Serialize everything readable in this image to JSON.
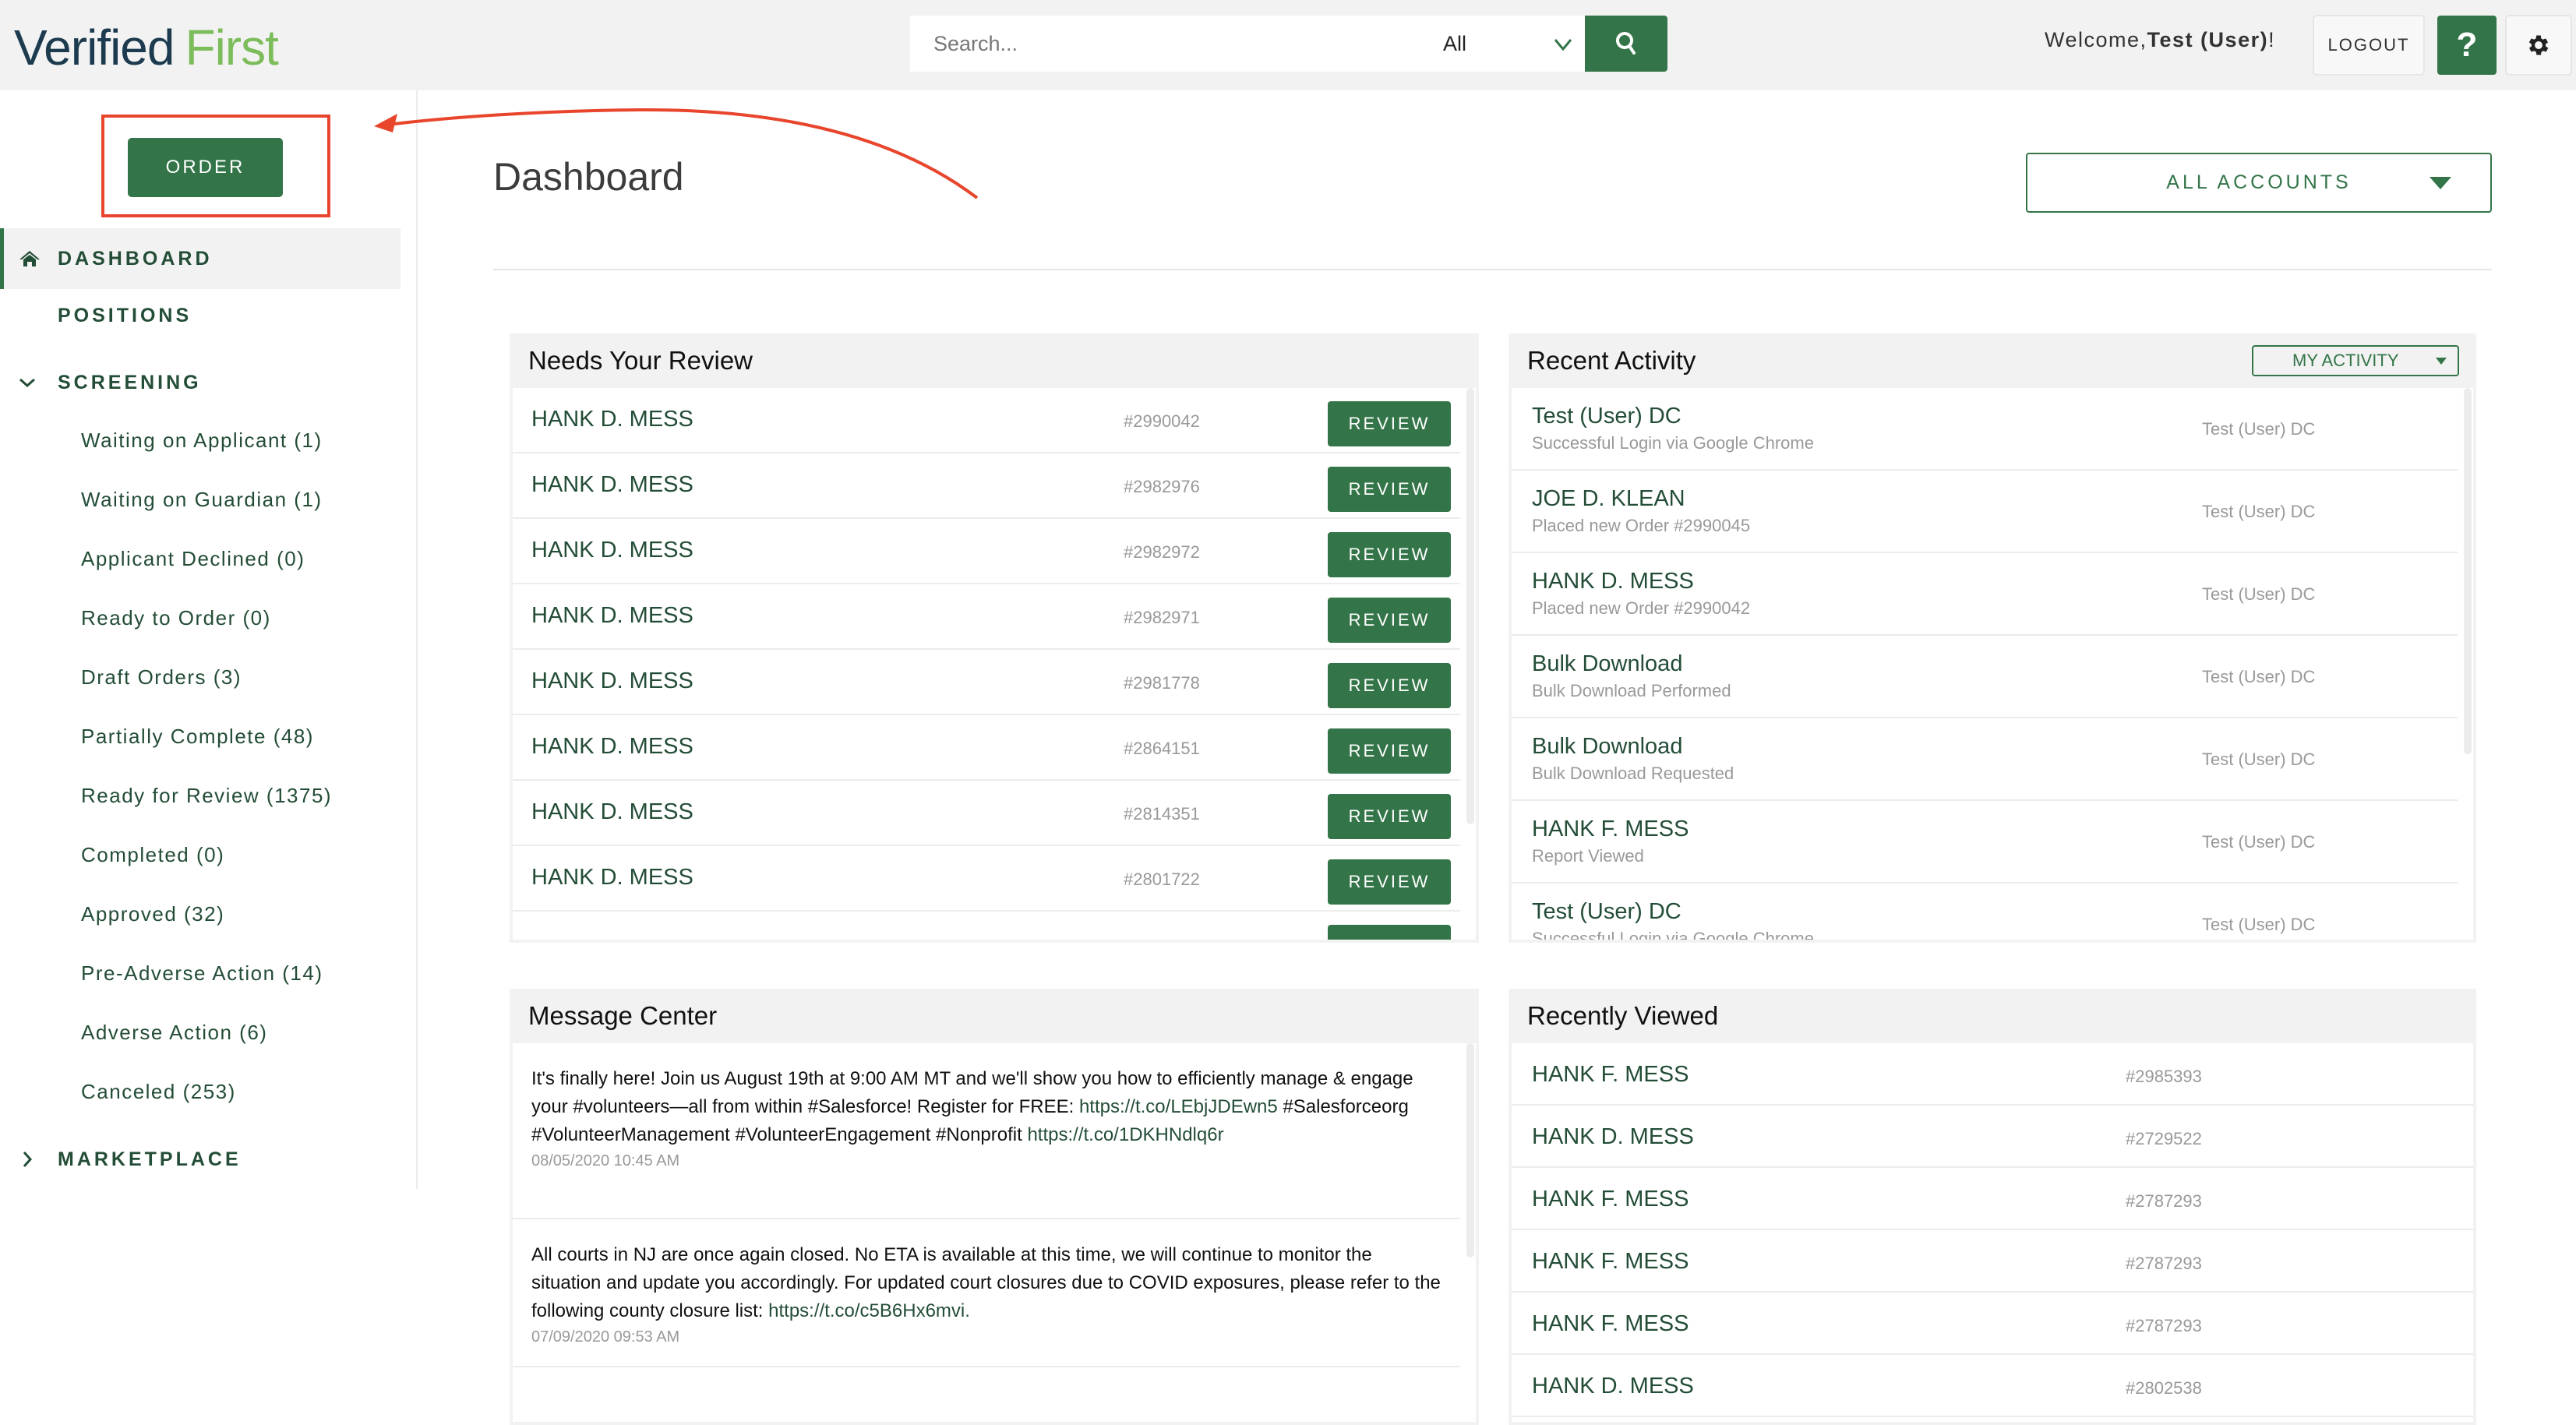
{
  "header": {
    "logo_part1": "Verified",
    "logo_part2": "First",
    "search_placeholder": "Search...",
    "search_scope": "All",
    "welcome_prefix": "Welcome,",
    "welcome_user": "Test (User)",
    "welcome_suffix": "!",
    "logout_label": "LOGOUT",
    "help_label": "?"
  },
  "sidebar": {
    "order_label": "ORDER",
    "top_items": [
      {
        "label": "DASHBOARD",
        "icon": "home-icon",
        "active": true
      },
      {
        "label": "POSITIONS"
      },
      {
        "label": "SCREENING",
        "icon": "chevron-down-icon",
        "expanded": true
      },
      {
        "label": "MARKETPLACE",
        "icon": "chevron-right-icon",
        "expanded": false
      }
    ],
    "screening_items": [
      "Waiting on Applicant (1)",
      "Waiting on Guardian (1)",
      "Applicant Declined (0)",
      "Ready to Order (0)",
      "Draft Orders (3)",
      "Partially Complete (48)",
      "Ready for Review (1375)",
      "Completed (0)",
      "Approved (32)",
      "Pre-Adverse Action (14)",
      "Adverse Action (6)",
      "Canceled (253)"
    ]
  },
  "main": {
    "title": "Dashboard",
    "accounts_dropdown": "ALL ACCOUNTS",
    "needs_review": {
      "title": "Needs Your Review",
      "button_label": "REVIEW",
      "rows": [
        {
          "name": "HANK D. MESS",
          "order": "#2990042"
        },
        {
          "name": "HANK D. MESS",
          "order": "#2982976"
        },
        {
          "name": "HANK D. MESS",
          "order": "#2982972"
        },
        {
          "name": "HANK D. MESS",
          "order": "#2982971"
        },
        {
          "name": "HANK D. MESS",
          "order": "#2981778"
        },
        {
          "name": "HANK D. MESS",
          "order": "#2864151"
        },
        {
          "name": "HANK D. MESS",
          "order": "#2814351"
        },
        {
          "name": "HANK D. MESS",
          "order": "#2801722"
        },
        {
          "name": "",
          "order": ""
        }
      ]
    },
    "recent_activity": {
      "title": "Recent Activity",
      "filter": "MY ACTIVITY",
      "rows": [
        {
          "title": "Test (User) DC",
          "sub": "Successful Login via Google Chrome",
          "user": "Test (User) DC"
        },
        {
          "title": "JOE D. KLEAN",
          "sub": "Placed new Order #2990045",
          "user": "Test (User) DC"
        },
        {
          "title": "HANK D. MESS",
          "sub": "Placed new Order #2990042",
          "user": "Test (User) DC"
        },
        {
          "title": "Bulk Download",
          "sub": "Bulk Download Performed",
          "user": "Test (User) DC"
        },
        {
          "title": "Bulk Download",
          "sub": "Bulk Download Requested",
          "user": "Test (User) DC"
        },
        {
          "title": "HANK F. MESS",
          "sub": "Report Viewed",
          "user": "Test (User) DC"
        },
        {
          "title": "Test (User) DC",
          "sub": "Successful Login via Google Chrome",
          "user": "Test (User) DC"
        }
      ]
    },
    "message_center": {
      "title": "Message Center",
      "messages": [
        {
          "text": "It's finally here! Join us August 19th at 9:00 AM MT and we'll show you how to efficiently manage & engage your #volunteers—all from within #Salesforce! Register for FREE: ",
          "link1": "https://t.co/LEbjJDEwn5",
          "text2": " #Salesforceorg #VolunteerManagement #VolunteerEngagement #Nonprofit ",
          "link2": "https://t.co/1DKHNdlq6r",
          "timestamp": "08/05/2020 10:45 AM"
        },
        {
          "text": "All courts in NJ are once again closed. No ETA is available at this time, we will continue to monitor the situation and update you accordingly. For updated court closures due to COVID exposures, please refer to the following county closure list: ",
          "link1": "https://t.co/c5B6Hx6mvi.",
          "timestamp": "07/09/2020 09:53 AM"
        }
      ]
    },
    "recently_viewed": {
      "title": "Recently Viewed",
      "rows": [
        {
          "name": "HANK F. MESS",
          "order": "#2985393"
        },
        {
          "name": "HANK D. MESS",
          "order": "#2729522"
        },
        {
          "name": "HANK F. MESS",
          "order": "#2787293"
        },
        {
          "name": "HANK F. MESS",
          "order": "#2787293"
        },
        {
          "name": "HANK F. MESS",
          "order": "#2787293"
        },
        {
          "name": "HANK D. MESS",
          "order": "#2802538"
        }
      ]
    }
  },
  "colors": {
    "brand_green": "#337548",
    "logo_dark": "#1d3b4f",
    "logo_light": "#7cbc5a",
    "annotation_red": "#e8452c",
    "nav_text": "#234d36"
  }
}
